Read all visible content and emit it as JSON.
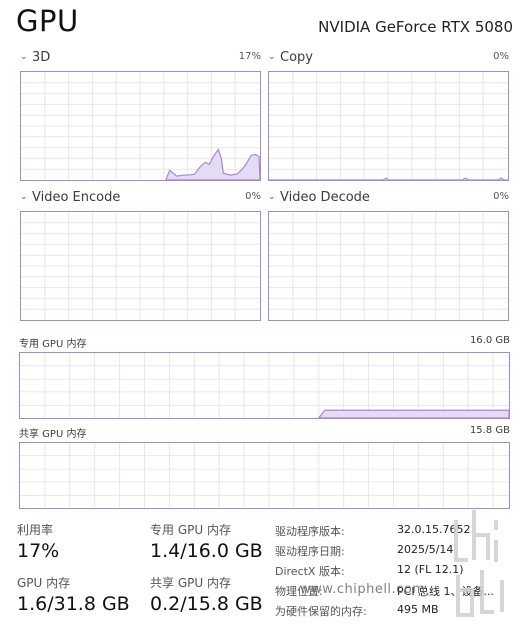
{
  "header": {
    "title": "GPU",
    "model": "NVIDIA GeForce RTX 5080"
  },
  "engines": [
    {
      "label": "3D",
      "percent": "17%"
    },
    {
      "label": "Copy",
      "percent": "0%"
    },
    {
      "label": "Video Encode",
      "percent": "0%"
    },
    {
      "label": "Video Decode",
      "percent": "0%"
    }
  ],
  "memory": {
    "dedicated": {
      "label": "专用 GPU 内存",
      "capacity": "16.0 GB"
    },
    "shared": {
      "label": "共享 GPU 内存",
      "capacity": "15.8 GB"
    }
  },
  "stats": {
    "utilization": {
      "label": "利用率",
      "value": "17%"
    },
    "dedicated": {
      "label": "专用 GPU 内存",
      "value": "1.4/16.0 GB"
    },
    "gpu_memory": {
      "label": "GPU 内存",
      "value": "1.6/31.8 GB"
    },
    "shared": {
      "label": "共享 GPU 内存",
      "value": "0.2/15.8 GB"
    }
  },
  "properties": [
    {
      "label": "驱动程序版本:",
      "value": "32.0.15.7652"
    },
    {
      "label": "驱动程序日期:",
      "value": "2025/5/14"
    },
    {
      "label": "DirectX 版本:",
      "value": "12 (FL 12.1)"
    },
    {
      "label": "物理位置:",
      "value": "PCI 总线 1、设备..."
    },
    {
      "label": "为硬件保留的内存:",
      "value": "495 MB"
    }
  ],
  "watermark": {
    "text": "www.chiphell.com"
  },
  "colors": {
    "accent": "#a58ad0",
    "fill": "#e6dbf5",
    "grid": "#e7e7e7"
  }
}
